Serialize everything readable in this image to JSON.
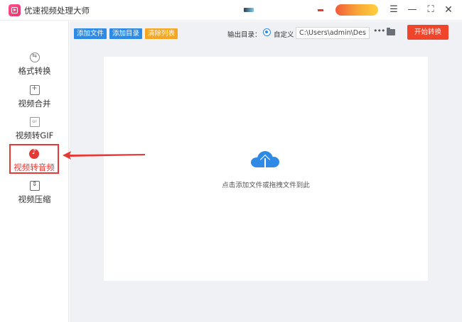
{
  "app": {
    "title": "优速视频处理大师"
  },
  "window_controls": {
    "menu_icon": "hamburger-menu-icon",
    "minimize_icon": "minimize-icon",
    "maximize_icon": "maximize-icon",
    "close_icon": "close-icon"
  },
  "sidebar": {
    "items": [
      {
        "label": "格式转换",
        "icon": "format-convert-icon",
        "active": false
      },
      {
        "label": "视频合并",
        "icon": "merge-icon",
        "active": false
      },
      {
        "label": "视频转GIF",
        "icon": "gif-icon",
        "active": false
      },
      {
        "label": "视频转音频",
        "icon": "audio-icon",
        "active": true
      },
      {
        "label": "视频压缩",
        "icon": "compress-icon",
        "active": false
      }
    ]
  },
  "toolbar": {
    "add_file": "添加文件",
    "add_dir": "添加目录",
    "clear_list": "清除列表",
    "output_label": "输出目录：",
    "custom_option": "自定义",
    "output_path": "C:\\Users\\admin\\Deskto",
    "more": "•••",
    "start": "开始转换"
  },
  "dropzone": {
    "hint": "点击添加文件或拖拽文件到此",
    "icon": "cloud-upload-icon"
  },
  "colors": {
    "primary": "#2f8ae6",
    "orange": "#f5a623",
    "start": "#f0442b",
    "highlight": "#e53935"
  }
}
